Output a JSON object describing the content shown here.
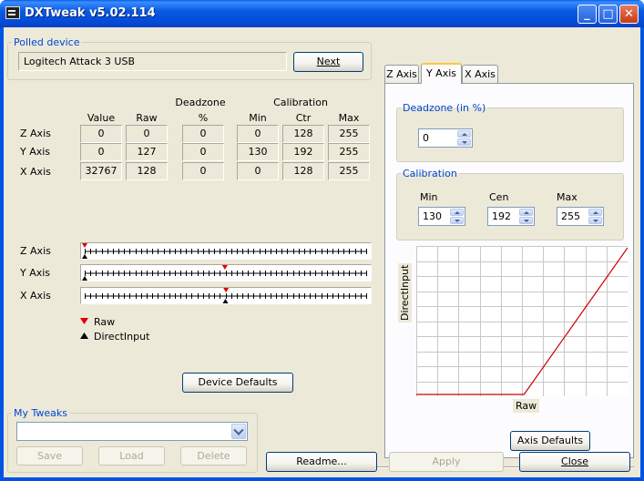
{
  "window": {
    "title": "DXTweak v5.02.114"
  },
  "polled_device": {
    "legend": "Polled device",
    "name": "Logitech Attack 3 USB",
    "next_label": "Next"
  },
  "table": {
    "headers": {
      "deadzone": "Deadzone",
      "calibration": "Calibration",
      "value": "Value",
      "raw": "Raw",
      "pct": "%",
      "min": "Min",
      "ctr": "Ctr",
      "max": "Max"
    },
    "rows": [
      {
        "axis": "Z Axis",
        "value": "0",
        "raw": "0",
        "deadzone": "0",
        "min": "0",
        "ctr": "128",
        "max": "255"
      },
      {
        "axis": "Y Axis",
        "value": "0",
        "raw": "127",
        "deadzone": "0",
        "min": "130",
        "ctr": "192",
        "max": "255"
      },
      {
        "axis": "X Axis",
        "value": "32767",
        "raw": "128",
        "deadzone": "0",
        "min": "0",
        "ctr": "128",
        "max": "255"
      }
    ]
  },
  "sliders": {
    "rows": [
      {
        "axis": "Z Axis",
        "raw_fraction": 0.0,
        "direct_fraction": 0.0
      },
      {
        "axis": "Y Axis",
        "raw_fraction": 0.498,
        "direct_fraction": 0.0
      },
      {
        "axis": "X Axis",
        "raw_fraction": 0.502,
        "direct_fraction": 0.5
      }
    ],
    "legend_raw": "Raw",
    "legend_direct": "DirectInput",
    "raw_color": "#e00000",
    "direct_color": "#000000"
  },
  "device_defaults_label": "Device Defaults",
  "my_tweaks": {
    "legend": "My Tweaks",
    "selected": "",
    "save": "Save",
    "load": "Load",
    "delete": "Delete"
  },
  "tabs": [
    {
      "label": "Z Axis"
    },
    {
      "label": "Y Axis"
    },
    {
      "label": "X Axis"
    }
  ],
  "active_tab": "Y Axis",
  "deadzone": {
    "legend": "Deadzone (in %)",
    "value": "0"
  },
  "calibration": {
    "legend": "Calibration",
    "min_label": "Min",
    "cen_label": "Cen",
    "max_label": "Max",
    "min": "130",
    "cen": "192",
    "max": "255"
  },
  "graph": {
    "ylabel": "DirectInput",
    "xlabel": "Raw",
    "line_color": "#cc0000",
    "flat_until_raw": 130,
    "full_at_raw": 255
  },
  "axis_defaults_label": "Axis Defaults",
  "buttons": {
    "readme": "Readme...",
    "apply": "Apply",
    "close": "Close"
  }
}
